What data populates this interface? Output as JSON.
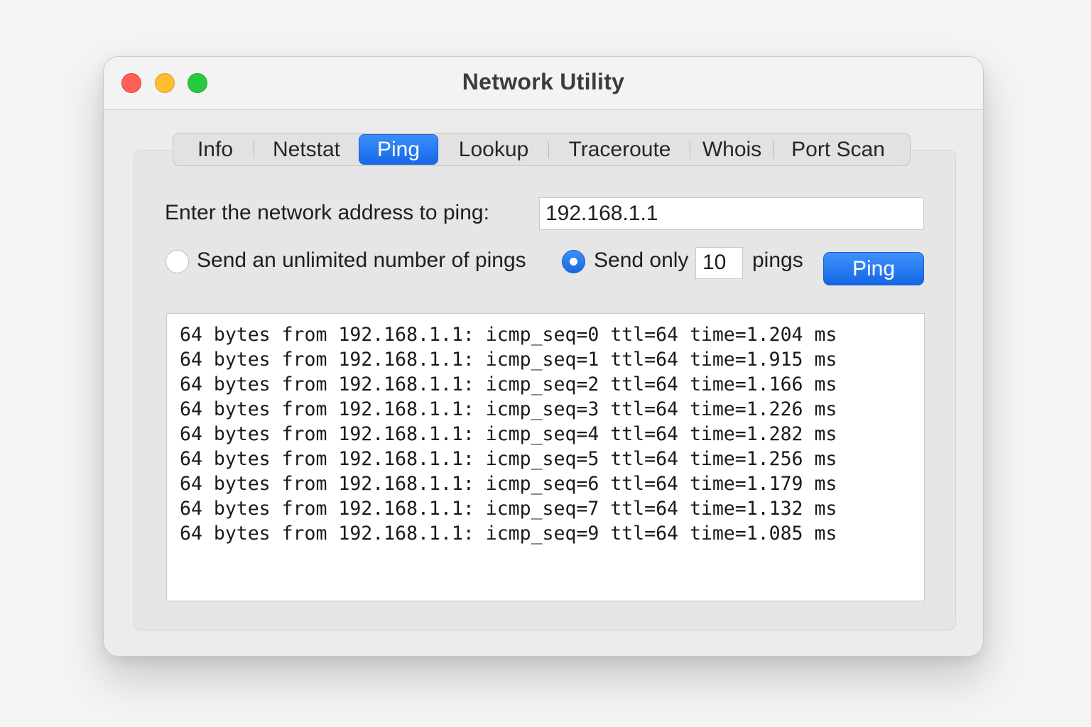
{
  "window": {
    "title": "Network Utility"
  },
  "tabs": [
    {
      "label": "Info",
      "active": false
    },
    {
      "label": "Netstat",
      "active": false
    },
    {
      "label": "Ping",
      "active": true
    },
    {
      "label": "Lookup",
      "active": false
    },
    {
      "label": "Traceroute",
      "active": false
    },
    {
      "label": "Whois",
      "active": false
    },
    {
      "label": "Port Scan",
      "active": false
    }
  ],
  "ping": {
    "address_label": "Enter the network address to ping:",
    "address_value": "192.168.1.1",
    "unlimited_label": "Send an unlimited number of pings",
    "unlimited_selected": false,
    "send_only_label": "Send only",
    "send_only_selected": true,
    "count_value": "10",
    "pings_label": "pings",
    "button_label": "Ping"
  },
  "output": {
    "lines": [
      "64 bytes from 192.168.1.1: icmp_seq=0 ttl=64 time=1.204 ms",
      "64 bytes from 192.168.1.1: icmp_seq=1 ttl=64 time=1.915 ms",
      "64 bytes from 192.168.1.1: icmp_seq=2 ttl=64 time=1.166 ms",
      "64 bytes from 192.168.1.1: icmp_seq=3 ttl=64 time=1.226 ms",
      "64 bytes from 192.168.1.1: icmp_seq=4 ttl=64 time=1.282 ms",
      "64 bytes from 192.168.1.1: icmp_seq=5 ttl=64 time=1.256 ms",
      "64 bytes from 192.168.1.1: icmp_seq=6 ttl=64 time=1.179 ms",
      "64 bytes from 192.168.1.1: icmp_seq=7 ttl=64 time=1.132 ms",
      "64 bytes from 192.168.1.1: icmp_seq=9 ttl=64 time=1.085 ms"
    ]
  },
  "colors": {
    "accent": "#1f76f0",
    "close": "#fe5f57",
    "minimize": "#febc2e",
    "zoom": "#28c840"
  }
}
